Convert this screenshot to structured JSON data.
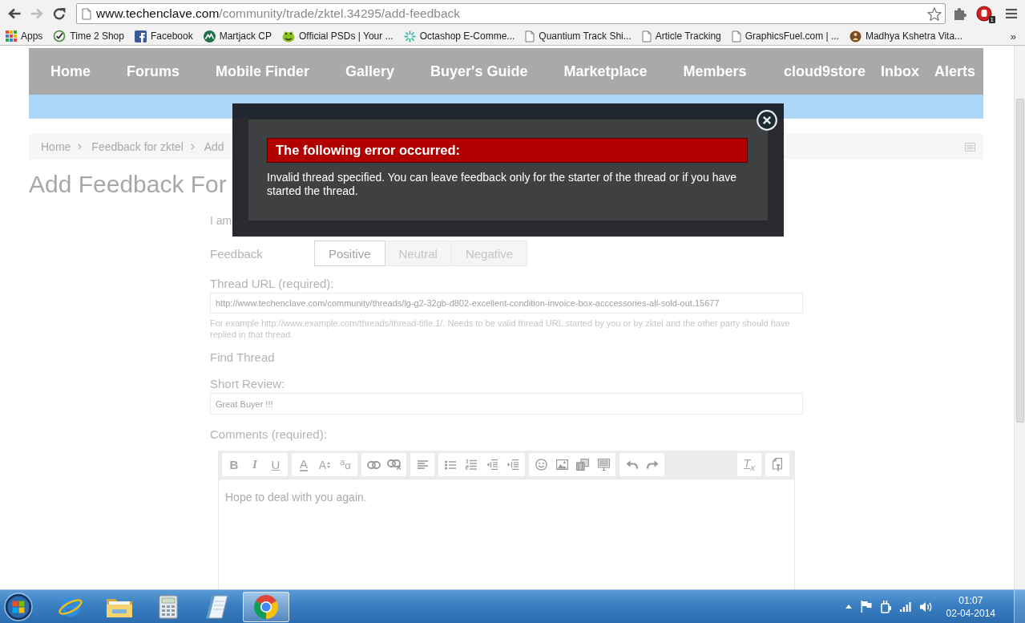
{
  "browser": {
    "forward_disabled": true,
    "url_host": "www.techenclave.com",
    "url_path": "/community/trade/zktel.34295/add-feedback",
    "extension_badge": "1"
  },
  "bookmarks": {
    "items": [
      {
        "kind": "apps",
        "label": "Apps"
      },
      {
        "kind": "swirl",
        "label": "Time 2 Shop"
      },
      {
        "kind": "fb",
        "label": "Facebook"
      },
      {
        "kind": "mountain",
        "label": "Martjack CP"
      },
      {
        "kind": "blob",
        "label": "Official PSDs | Your ..."
      },
      {
        "kind": "sparkle",
        "label": "Octashop E-Comme..."
      },
      {
        "kind": "page",
        "label": "Quantium Track Shi..."
      },
      {
        "kind": "page",
        "label": "Article Tracking"
      },
      {
        "kind": "page",
        "label": "GraphicsFuel.com | ..."
      },
      {
        "kind": "emblem",
        "label": "Madhya Kshetra Vita..."
      }
    ],
    "more": "»"
  },
  "nav": {
    "tabs": [
      "Home",
      "Forums",
      "Mobile Finder",
      "Gallery",
      "Buyer's Guide",
      "Marketplace",
      "Members"
    ],
    "account_tabs": [
      "cloud9store",
      "Inbox",
      "Alerts"
    ]
  },
  "breadcrumb": [
    "Home",
    "Feedback for zktel",
    "Add"
  ],
  "page_title": "Add Feedback For",
  "form": {
    "role_label": "I am",
    "feedback": {
      "label": "Feedback",
      "options": [
        {
          "label": "Positive",
          "selected": true
        },
        {
          "label": "Neutral",
          "selected": false
        },
        {
          "label": "Negative",
          "selected": false
        }
      ]
    },
    "thread_url": {
      "label": "Thread URL (required):",
      "value": "http://www.techenclave.com/community/threads/lg-g2-32gb-d802-excellent-condition-invoice-box-acccessories-all-sold-out.15677",
      "hint": "For example http://www.example.com/threads/thread-title.1/. Needs to be valid thread URL started by you or by zktel and the other party should have replied in that thread."
    },
    "find_thread": "Find Thread",
    "short_review": {
      "label": "Short Review:",
      "value": "Great Buyer !!!"
    },
    "comments": {
      "label": "Comments (required):",
      "toolbar": {
        "groups": [
          {
            "buttons": [
              {
                "kind": "bold",
                "glyph": "B"
              },
              {
                "kind": "italic",
                "glyph": "I"
              },
              {
                "kind": "underline",
                "glyph": "U"
              }
            ]
          },
          {
            "buttons": [
              {
                "kind": "fontcolor",
                "glyph": "A"
              },
              {
                "kind": "fontsize",
                "glyph": "A"
              },
              {
                "kind": "fontfamily",
                "glyph": "$^{a}$α"
              }
            ]
          },
          {
            "buttons": [
              {
                "kind": "link"
              },
              {
                "kind": "unlink"
              }
            ]
          },
          {
            "buttons": [
              {
                "kind": "align"
              }
            ]
          },
          {
            "buttons": [
              {
                "kind": "bullets"
              },
              {
                "kind": "numbers"
              },
              {
                "kind": "outdent"
              },
              {
                "kind": "indent"
              }
            ]
          },
          {
            "buttons": [
              {
                "kind": "smiley"
              },
              {
                "kind": "image"
              },
              {
                "kind": "media"
              },
              {
                "kind": "template"
              }
            ]
          },
          {
            "buttons": [
              {
                "kind": "undo"
              },
              {
                "kind": "redo"
              }
            ]
          }
        ],
        "right_groups": [
          {
            "buttons": [
              {
                "kind": "removeformat",
                "glyph": "T$_{x}$"
              }
            ]
          },
          {
            "buttons": [
              {
                "kind": "toggle"
              }
            ]
          }
        ]
      },
      "value": "Hope to deal with you again."
    }
  },
  "error_dialog": {
    "title": "The following error occurred:",
    "message": "Invalid thread specified. You can leave feedback only for the starter of the thread or if you have started the thread."
  },
  "taskbar": {
    "apps": [
      {
        "kind": "globe",
        "selected": false
      },
      {
        "kind": "folder",
        "selected": false
      },
      {
        "kind": "calculator",
        "selected": false
      },
      {
        "kind": "notepad",
        "selected": false
      },
      {
        "kind": "wheel",
        "selected": true
      }
    ],
    "clock": {
      "time": "01:07",
      "date": "02-04-2014"
    }
  }
}
